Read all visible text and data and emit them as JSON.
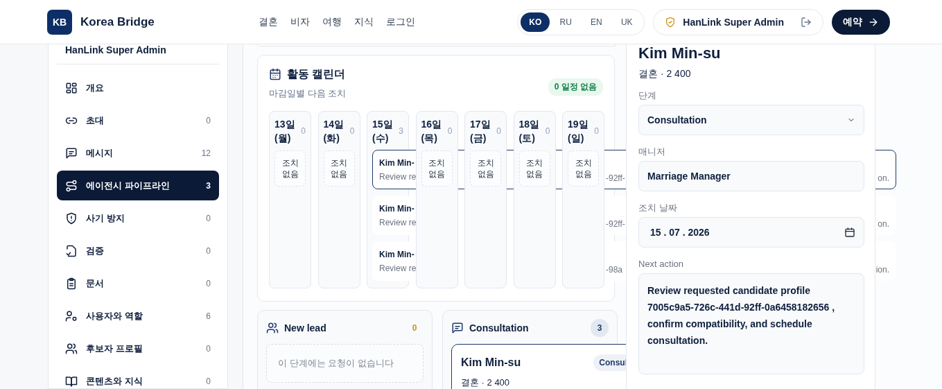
{
  "header": {
    "logo": "KB",
    "brand": "Korea Bridge",
    "nav": [
      "결혼",
      "비자",
      "여행",
      "지식",
      "로그인"
    ],
    "languages": [
      {
        "label": "KO",
        "selected": true
      },
      {
        "label": "RU",
        "selected": false
      },
      {
        "label": "EN",
        "selected": false
      },
      {
        "label": "UK",
        "selected": false
      }
    ],
    "user": "HanLink Super Admin",
    "book_button": "예약"
  },
  "sidebar": {
    "title": "HanLink Super Admin",
    "items": [
      {
        "label": "개요",
        "selected": false
      },
      {
        "label": "초대",
        "count": "0",
        "selected": false
      },
      {
        "label": "메시지",
        "count": "12",
        "selected": false
      },
      {
        "label": "에이전시 파이프라인",
        "count": "3",
        "selected": true
      },
      {
        "label": "사기 방지",
        "count": "0",
        "selected": false
      },
      {
        "label": "검증",
        "count": "0",
        "selected": false
      },
      {
        "label": "문서",
        "count": "0",
        "selected": false
      },
      {
        "label": "사용자와 역할",
        "count": "6",
        "selected": false
      },
      {
        "label": "후보자 프로필",
        "count": "0",
        "selected": false
      },
      {
        "label": "콘텐츠와 지식",
        "count": "0",
        "selected": false
      }
    ]
  },
  "calendar": {
    "title": "활동 캘린더",
    "subtitle": "마감일별 다음 조치",
    "badge": "0 일정 없음",
    "days": [
      {
        "label": "13일 (월)",
        "count": "0",
        "empty_text": "조치 없음"
      },
      {
        "label": "14일 (화)",
        "count": "0",
        "empty_text": "조치 없음"
      },
      {
        "label": "15일 (수)",
        "count": "3",
        "events": [
          {
            "name": "Kim Min-",
            "line": "Review re",
            "fragments": [
              "-92ff-",
              "on."
            ],
            "selected": true
          },
          {
            "name": "Kim Min-",
            "line": "Review re",
            "fragments": [
              "-92ff-",
              "on."
            ],
            "selected": false
          },
          {
            "name": "Kim Min-",
            "line": "Review re",
            "fragments": [
              "-98a",
              "ion."
            ],
            "selected": false
          }
        ]
      },
      {
        "label": "16일 (목)",
        "count": "0",
        "empty_text": "조치 없음"
      },
      {
        "label": "17일 (금)",
        "count": "0",
        "empty_text": "조치 없음"
      },
      {
        "label": "18일 (토)",
        "count": "0",
        "empty_text": "조치 없음"
      },
      {
        "label": "19일 (일)",
        "count": "0",
        "empty_text": "조치 없음"
      }
    ]
  },
  "pipeline": {
    "stages": [
      {
        "name": "New lead",
        "count": "0",
        "color": "#c9961a",
        "empty_text": "이 단계에는 요청이 없습니다"
      },
      {
        "name": "Consultation",
        "count": "3",
        "color": "#1e3a6b",
        "requests": [
          {
            "name": "Kim Min-su",
            "chip": "Consul",
            "meta": "결혼 · 2 400",
            "selected": true
          }
        ]
      }
    ]
  },
  "drawer": {
    "name": "Kim Min-su",
    "meta": "결혼 · 2 400",
    "fields": [
      {
        "kind": "select",
        "label": "단계",
        "value": "Consultation"
      },
      {
        "kind": "text",
        "label": "매니저",
        "value": "Marriage Manager"
      },
      {
        "kind": "date",
        "label": "조치 날짜",
        "value": "15 . 07 . 2026"
      },
      {
        "kind": "textarea",
        "label": "Next action",
        "value": "Review requested candidate profile 7005c9a5-726c-441d-92ff-0a6458182656 , confirm compatibility, and schedule consultation."
      }
    ]
  }
}
